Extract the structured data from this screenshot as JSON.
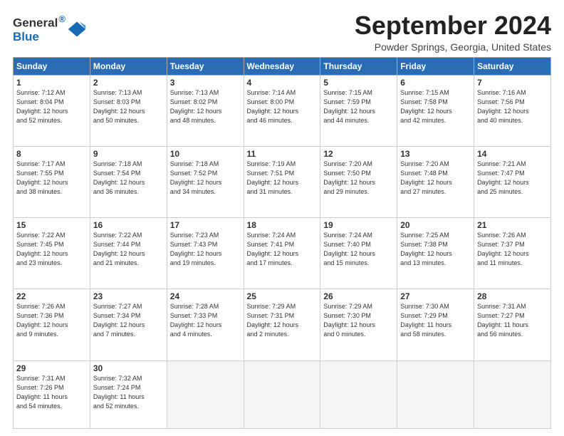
{
  "header": {
    "logo_line1": "General",
    "logo_line2": "Blue",
    "month_title": "September 2024",
    "location": "Powder Springs, Georgia, United States"
  },
  "days_of_week": [
    "Sunday",
    "Monday",
    "Tuesday",
    "Wednesday",
    "Thursday",
    "Friday",
    "Saturday"
  ],
  "weeks": [
    [
      {
        "num": "1",
        "sunrise": "7:12 AM",
        "sunset": "8:04 PM",
        "daylight": "12 hours and 52 minutes."
      },
      {
        "num": "2",
        "sunrise": "7:13 AM",
        "sunset": "8:03 PM",
        "daylight": "12 hours and 50 minutes."
      },
      {
        "num": "3",
        "sunrise": "7:13 AM",
        "sunset": "8:02 PM",
        "daylight": "12 hours and 48 minutes."
      },
      {
        "num": "4",
        "sunrise": "7:14 AM",
        "sunset": "8:00 PM",
        "daylight": "12 hours and 46 minutes."
      },
      {
        "num": "5",
        "sunrise": "7:15 AM",
        "sunset": "7:59 PM",
        "daylight": "12 hours and 44 minutes."
      },
      {
        "num": "6",
        "sunrise": "7:15 AM",
        "sunset": "7:58 PM",
        "daylight": "12 hours and 42 minutes."
      },
      {
        "num": "7",
        "sunrise": "7:16 AM",
        "sunset": "7:56 PM",
        "daylight": "12 hours and 40 minutes."
      }
    ],
    [
      {
        "num": "8",
        "sunrise": "7:17 AM",
        "sunset": "7:55 PM",
        "daylight": "12 hours and 38 minutes."
      },
      {
        "num": "9",
        "sunrise": "7:18 AM",
        "sunset": "7:54 PM",
        "daylight": "12 hours and 36 minutes."
      },
      {
        "num": "10",
        "sunrise": "7:18 AM",
        "sunset": "7:52 PM",
        "daylight": "12 hours and 34 minutes."
      },
      {
        "num": "11",
        "sunrise": "7:19 AM",
        "sunset": "7:51 PM",
        "daylight": "12 hours and 31 minutes."
      },
      {
        "num": "12",
        "sunrise": "7:20 AM",
        "sunset": "7:50 PM",
        "daylight": "12 hours and 29 minutes."
      },
      {
        "num": "13",
        "sunrise": "7:20 AM",
        "sunset": "7:48 PM",
        "daylight": "12 hours and 27 minutes."
      },
      {
        "num": "14",
        "sunrise": "7:21 AM",
        "sunset": "7:47 PM",
        "daylight": "12 hours and 25 minutes."
      }
    ],
    [
      {
        "num": "15",
        "sunrise": "7:22 AM",
        "sunset": "7:45 PM",
        "daylight": "12 hours and 23 minutes."
      },
      {
        "num": "16",
        "sunrise": "7:22 AM",
        "sunset": "7:44 PM",
        "daylight": "12 hours and 21 minutes."
      },
      {
        "num": "17",
        "sunrise": "7:23 AM",
        "sunset": "7:43 PM",
        "daylight": "12 hours and 19 minutes."
      },
      {
        "num": "18",
        "sunrise": "7:24 AM",
        "sunset": "7:41 PM",
        "daylight": "12 hours and 17 minutes."
      },
      {
        "num": "19",
        "sunrise": "7:24 AM",
        "sunset": "7:40 PM",
        "daylight": "12 hours and 15 minutes."
      },
      {
        "num": "20",
        "sunrise": "7:25 AM",
        "sunset": "7:38 PM",
        "daylight": "12 hours and 13 minutes."
      },
      {
        "num": "21",
        "sunrise": "7:26 AM",
        "sunset": "7:37 PM",
        "daylight": "12 hours and 11 minutes."
      }
    ],
    [
      {
        "num": "22",
        "sunrise": "7:26 AM",
        "sunset": "7:36 PM",
        "daylight": "12 hours and 9 minutes."
      },
      {
        "num": "23",
        "sunrise": "7:27 AM",
        "sunset": "7:34 PM",
        "daylight": "12 hours and 7 minutes."
      },
      {
        "num": "24",
        "sunrise": "7:28 AM",
        "sunset": "7:33 PM",
        "daylight": "12 hours and 4 minutes."
      },
      {
        "num": "25",
        "sunrise": "7:29 AM",
        "sunset": "7:31 PM",
        "daylight": "12 hours and 2 minutes."
      },
      {
        "num": "26",
        "sunrise": "7:29 AM",
        "sunset": "7:30 PM",
        "daylight": "12 hours and 0 minutes."
      },
      {
        "num": "27",
        "sunrise": "7:30 AM",
        "sunset": "7:29 PM",
        "daylight": "11 hours and 58 minutes."
      },
      {
        "num": "28",
        "sunrise": "7:31 AM",
        "sunset": "7:27 PM",
        "daylight": "11 hours and 56 minutes."
      }
    ],
    [
      {
        "num": "29",
        "sunrise": "7:31 AM",
        "sunset": "7:26 PM",
        "daylight": "11 hours and 54 minutes."
      },
      {
        "num": "30",
        "sunrise": "7:32 AM",
        "sunset": "7:24 PM",
        "daylight": "11 hours and 52 minutes."
      },
      null,
      null,
      null,
      null,
      null
    ]
  ]
}
